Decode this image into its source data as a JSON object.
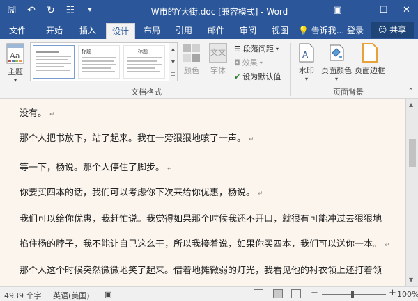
{
  "window": {
    "title": "W市的Y大街.doc [兼容模式] - Word",
    "icons": [
      "save-icon",
      "undo-icon",
      "redo-icon",
      "touch-mode-icon",
      "customize-qat-icon",
      "ribbon-display-options-icon",
      "minimize-icon",
      "restore-icon",
      "close-icon"
    ]
  },
  "tabs": [
    {
      "label": "文件"
    },
    {
      "label": "开始"
    },
    {
      "label": "插入"
    },
    {
      "label": "设计",
      "active": true
    },
    {
      "label": "布局"
    },
    {
      "label": "引用"
    },
    {
      "label": "邮件"
    },
    {
      "label": "审阅"
    },
    {
      "label": "视图"
    }
  ],
  "tell_me": "告诉我...",
  "login": "登录",
  "share": "共享",
  "ribbon": {
    "theme_label": "主题",
    "gallery": {
      "thumb1_title": "标题",
      "thumb2_title": "标题",
      "thumb3_title": "标题"
    },
    "colors_label": "颜色",
    "fonts_label": "字体",
    "fonts_icon_text": "文文",
    "paragraph_spacing": "段落间距",
    "effects": "效果",
    "set_default": "设为默认值",
    "watermark": "水印",
    "page_color": "页面颜色",
    "page_border": "页面边框",
    "group_doc_format": "文档格式",
    "group_page_bg": "页面背景"
  },
  "document": {
    "paragraphs": [
      "没有。",
      "那个人把书放下，站了起来。我在一旁狠狠地咳了一声。",
      "等一下，杨说。那个人停住了脚步。",
      "你要买四本的话，我们可以考虑你下次来给你优惠，杨说。",
      "我们可以给你优惠，我赶忙说。我觉得如果那个时候我还不开口，就很有可能冲过去狠狠地",
      "掐住杨的脖子，我不能让自己这么干，所以我接着说，如果你买四本，我们可以送你一本。",
      "那个人这个时候突然微微地笑了起来。借着地摊微弱的灯光，我看见他的衬衣领上还打着领"
    ],
    "paragraph_mark": "↵"
  },
  "status": {
    "word_count": "4939 个字",
    "language": "英语(美国)",
    "zoom_minus": "−",
    "zoom_plus": "+",
    "zoom": "100%"
  }
}
